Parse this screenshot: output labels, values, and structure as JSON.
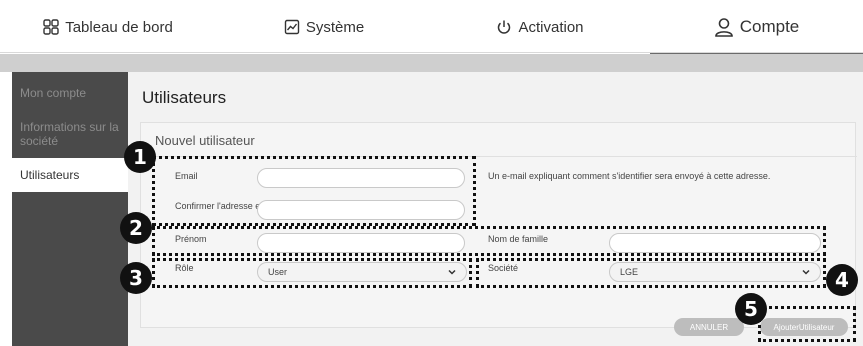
{
  "tabs": [
    {
      "label": "Tableau de bord",
      "icon": "dashboard-grid-icon"
    },
    {
      "label": "Système",
      "icon": "chart-icon"
    },
    {
      "label": "Activation",
      "icon": "power-icon"
    },
    {
      "label": "Compte",
      "icon": "user-icon",
      "active": true
    }
  ],
  "sidebar": {
    "items": [
      {
        "label": "Mon compte"
      },
      {
        "label": "Informations sur la société"
      },
      {
        "label": "Utilisateurs",
        "active": true
      }
    ]
  },
  "main": {
    "title": "Utilisateurs",
    "card_title": "Nouvel utilisateur",
    "form": {
      "email_label": "Email",
      "email_value": "",
      "confirm_email_label": "Confirmer l'adresse e-mail",
      "confirm_email_value": "",
      "email_note": "Un e-mail expliquant comment s'identifier sera envoyé à cette adresse.",
      "firstname_label": "Prénom",
      "firstname_value": "",
      "lastname_label": "Nom de famille",
      "lastname_value": "",
      "role_label": "Rôle",
      "role_selected": "User",
      "company_label": "Société",
      "company_selected": "LGE"
    },
    "buttons": {
      "cancel": "ANNULER",
      "add_user": "AjouterUtilisateur"
    }
  },
  "callouts": [
    "1",
    "2",
    "3",
    "4",
    "5"
  ],
  "colors": {
    "sidebar_bg": "#4a4a4a",
    "content_bg": "#f2f2f2",
    "button_gray": "#bdbdbd",
    "callout": "#111111"
  }
}
